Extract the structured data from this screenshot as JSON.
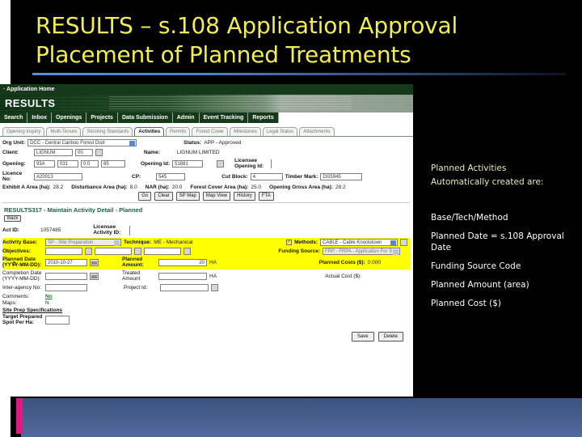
{
  "slide": {
    "title_line1": "RESULTS – s.108 Application Approval",
    "title_line2": "Placement of Planned Treatments",
    "title_color": "#f2ee4f",
    "accent_pink": "#e2197f",
    "footer_blue": "#4a628e"
  },
  "bullets": {
    "heading_line1": "Planned Activities",
    "heading_line2": "Automatically created are:",
    "items": [
      "Base/Tech/Method",
      "Planned Date = s.108 Approval Date",
      "Funding Source Code",
      "Planned Amount  (area)",
      "Planned Cost ($)"
    ]
  },
  "app": {
    "app_home": "· Application Home",
    "brand": "RESULTS",
    "nav": [
      "Search",
      "Inbox",
      "Openings",
      "Projects",
      "Data Submission",
      "Admin",
      "Event Tracking",
      "Reports"
    ],
    "subtabs": [
      {
        "label": "Opening Inquiry",
        "active": false
      },
      {
        "label": "Multi-Tenure",
        "active": false
      },
      {
        "label": "Stocking Standards",
        "active": false
      },
      {
        "label": "Activities",
        "active": true
      },
      {
        "label": "Permits",
        "active": false
      },
      {
        "label": "Forest Cover",
        "active": false
      },
      {
        "label": "Milestones",
        "active": false
      },
      {
        "label": "Legal Status",
        "active": false
      },
      {
        "label": "Attachments",
        "active": false
      }
    ],
    "header_form": {
      "org_unit_label": "Org Unit:",
      "org_unit_value": "DCC - Central Cariboo Forest Distr",
      "status_label": "Status:",
      "status_value": "APP - Approved",
      "client_label": "Client:",
      "client_value": "LIGNUM",
      "client_loc": "00",
      "name_label": "Name:",
      "name_value": "LIGNUM LIMITED",
      "opening_label": "Opening:",
      "opening_p1": "93A",
      "opening_p2": "031",
      "opening_p3": "0.0",
      "opening_p4": "85",
      "opening_id_label": "Opening Id:",
      "opening_id_value": "51881",
      "licensee_opening_id_label": "Licensee Opening Id:",
      "licence_no_label": "Licence No:",
      "licence_no_value": "A20013",
      "cp_label": "CP:",
      "cp_value": "545",
      "cut_block_label": "Cut Block:",
      "cut_block_value": "4",
      "timber_mark_label": "Timber Mark:",
      "timber_mark_value": "DG5945",
      "areas": [
        {
          "label": "Exhibit A Area (ha):",
          "value": "28.2"
        },
        {
          "label": "Disturbance Area (ha):",
          "value": "8.0"
        },
        {
          "label": "NAR (ha):",
          "value": "20.0"
        },
        {
          "label": "Forest Cover Area (ha):",
          "value": "25.0"
        },
        {
          "label": "Opening Gross Area (ha):",
          "value": "28.2"
        }
      ],
      "buttons": [
        "Go",
        "Clear",
        "SP Map",
        "Map View",
        "History",
        "FTA"
      ]
    },
    "detail": {
      "section_title": "RESULTS317 - Maintain Activity Detail - Planned",
      "back_button": "Back",
      "act_id_label": "Act ID:",
      "act_id_value": "1057485",
      "licensee_activity_id_label": "Licensee Activity ID:",
      "activity_base_label": "Activity Base:",
      "activity_base_value": "SP - Site Preparation",
      "technique_label": "Technique:",
      "technique_value": "ME - Mechanical",
      "methods_label": "Methods:",
      "methods_value": "CABLE - Cable Knockdown",
      "objectives_label": "Objectives:",
      "funding_source_label": "Funding Source:",
      "funding_source_value": "FRP - FRPA - Application For S",
      "planned_date_label": "Planned Date (YYYY-MM-DD):",
      "planned_date_value": "2010-10-27",
      "planned_amount_label": "Planned Amount:",
      "planned_amount_value": "20",
      "planned_amount_unit": "HA",
      "planned_costs_label": "Planned Costs ($):",
      "planned_costs_value": "0.000",
      "completion_date_label": "Completion Date (YYYY-MM-DD):",
      "completion_date_value": "",
      "treated_amount_label": "Treated Amount",
      "treated_amount_value": "",
      "treated_amount_unit": "HA",
      "actual_cost_label": "Actual Cost ($):",
      "actual_cost_value": "",
      "inter_agency_label": "Inter-agency No:",
      "inter_agency_value": "",
      "project_id_label": "Project Id:",
      "project_id_value": "",
      "comments_label": "Comments:",
      "comments_value": "No",
      "maps_label": "Maps:",
      "maps_value": "N",
      "spec_title": "Site Prep Specifications",
      "target_label": "Target Prepared Spot Per Ha:",
      "target_value": "",
      "save_button": "Save",
      "delete_button": "Delete"
    }
  }
}
